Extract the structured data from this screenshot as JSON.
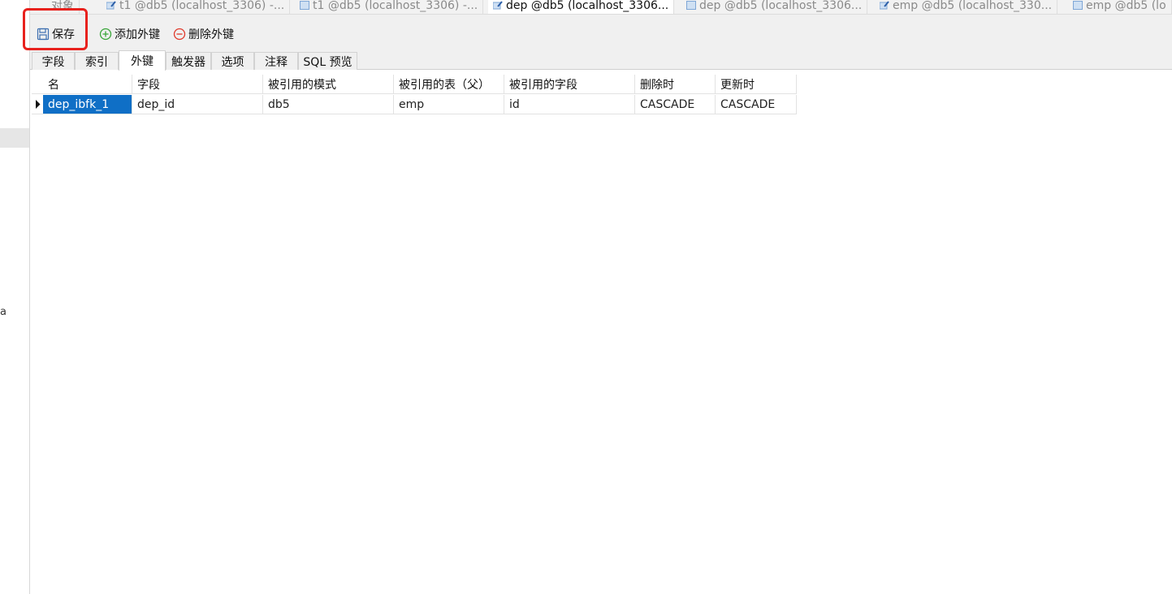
{
  "tabs": [
    {
      "label": "对象",
      "icon": "",
      "active": false
    },
    {
      "label": "t1 @db5 (localhost_3306) -...",
      "icon": "table-edit-icon",
      "active": false
    },
    {
      "label": "t1 @db5 (localhost_3306) -...",
      "icon": "table-icon",
      "active": false
    },
    {
      "label": "dep @db5 (localhost_3306...",
      "icon": "table-edit-icon",
      "active": true
    },
    {
      "label": "dep @db5 (localhost_3306...",
      "icon": "table-icon",
      "active": false
    },
    {
      "label": "emp @db5 (localhost_330...",
      "icon": "table-edit-icon",
      "active": false
    },
    {
      "label": "emp @db5 (lo",
      "icon": "table-icon",
      "active": false
    }
  ],
  "toolbar": {
    "save_label": "保存",
    "add_fk_label": "添加外键",
    "delete_fk_label": "删除外键"
  },
  "subtabs": [
    "字段",
    "索引",
    "外键",
    "触发器",
    "选项",
    "注释",
    "SQL 预览"
  ],
  "active_subtab": "外键",
  "grid": {
    "columns": [
      "名",
      "字段",
      "被引用的模式",
      "被引用的表（父）",
      "被引用的字段",
      "删除时",
      "更新时"
    ],
    "rows": [
      [
        "dep_ibfk_1",
        "dep_id",
        "db5",
        "emp",
        "id",
        "CASCADE",
        "CASCADE"
      ]
    ]
  },
  "left_panel_fragment": "a",
  "colors": {
    "highlight": "#e8211d",
    "selection": "#0f6fc6",
    "add_icon": "#3aa63a",
    "delete_icon": "#e0392b"
  }
}
